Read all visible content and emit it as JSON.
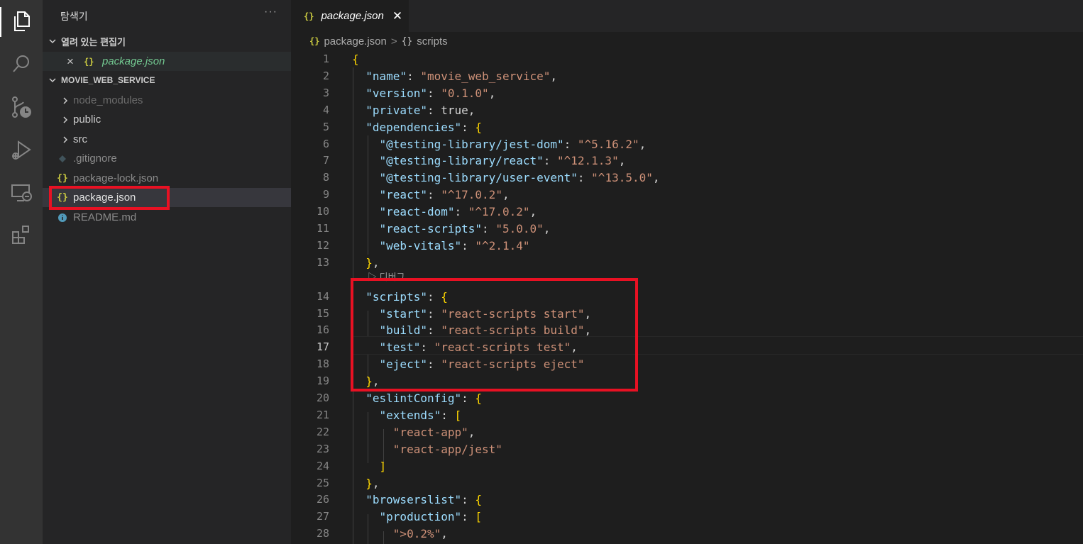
{
  "sidebar": {
    "title": "탐색기",
    "more": "···",
    "open_editors": {
      "header": "열려 있는 편집기",
      "items": [
        {
          "close": "×",
          "icon": "{}",
          "label": "package.json"
        }
      ]
    },
    "project": {
      "header": "MOVIE_WEB_SERVICE",
      "items": [
        {
          "type": "folder",
          "label": "node_modules",
          "icon": "chevron-right-icon"
        },
        {
          "type": "folder",
          "label": "public",
          "icon": "chevron-right-icon"
        },
        {
          "type": "folder",
          "label": "src",
          "icon": "chevron-right-icon"
        },
        {
          "type": "file",
          "label": ".gitignore",
          "icon": "git-icon"
        },
        {
          "type": "file",
          "label": "package-lock.json",
          "icon": "json-icon"
        },
        {
          "type": "file",
          "label": "package.json",
          "icon": "json-icon",
          "selected": true
        },
        {
          "type": "file",
          "label": "README.md",
          "icon": "info-icon"
        }
      ]
    }
  },
  "tab": {
    "icon": "{}",
    "label": "package.json",
    "close": "✕"
  },
  "breadcrumb": {
    "file": "package.json",
    "separator": ">",
    "braces": "{}",
    "section": "scripts"
  },
  "editor": {
    "codelens": "▷ 디버그",
    "lines": [
      {
        "n": "1",
        "text": "{"
      },
      {
        "n": "2",
        "text": "  \"name\": \"movie_web_service\","
      },
      {
        "n": "3",
        "text": "  \"version\": \"0.1.0\","
      },
      {
        "n": "4",
        "text": "  \"private\": true,"
      },
      {
        "n": "5",
        "text": "  \"dependencies\": {"
      },
      {
        "n": "6",
        "text": "    \"@testing-library/jest-dom\": \"^5.16.2\","
      },
      {
        "n": "7",
        "text": "    \"@testing-library/react\": \"^12.1.3\","
      },
      {
        "n": "8",
        "text": "    \"@testing-library/user-event\": \"^13.5.0\","
      },
      {
        "n": "9",
        "text": "    \"react\": \"^17.0.2\","
      },
      {
        "n": "10",
        "text": "    \"react-dom\": \"^17.0.2\","
      },
      {
        "n": "11",
        "text": "    \"react-scripts\": \"5.0.0\","
      },
      {
        "n": "12",
        "text": "    \"web-vitals\": \"^2.1.4\""
      },
      {
        "n": "13",
        "text": "  },"
      },
      {
        "n": "14",
        "text": "  \"scripts\": {"
      },
      {
        "n": "15",
        "text": "    \"start\": \"react-scripts start\","
      },
      {
        "n": "16",
        "text": "    \"build\": \"react-scripts build\","
      },
      {
        "n": "17",
        "text": "    \"test\": \"react-scripts test\","
      },
      {
        "n": "18",
        "text": "    \"eject\": \"react-scripts eject\""
      },
      {
        "n": "19",
        "text": "  },"
      },
      {
        "n": "20",
        "text": "  \"eslintConfig\": {"
      },
      {
        "n": "21",
        "text": "    \"extends\": ["
      },
      {
        "n": "22",
        "text": "      \"react-app\","
      },
      {
        "n": "23",
        "text": "      \"react-app/jest\""
      },
      {
        "n": "24",
        "text": "    ]"
      },
      {
        "n": "25",
        "text": "  },"
      },
      {
        "n": "26",
        "text": "  \"browserslist\": {"
      },
      {
        "n": "27",
        "text": "    \"production\": ["
      },
      {
        "n": "28",
        "text": "      \">0.2%\","
      }
    ]
  },
  "colors": {
    "highlight_box": "#e81123",
    "json_icon": "#cbcb41"
  }
}
